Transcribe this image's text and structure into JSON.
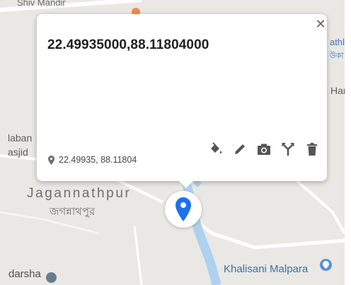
{
  "map": {
    "labels": {
      "top_left": "Shiv Mandir",
      "jagannathpur": "Jagannathpur",
      "jagannathpur_bn": "জগন্নাথপুর",
      "darsha": "darsha",
      "khalisani": "Khalisani Malpara",
      "left_partial_1": "laban",
      "left_partial_2": "asjid",
      "right_partial_1": "athle",
      "right_partial_2": "উকা",
      "right_partial_3": "Har"
    },
    "colors": {
      "land": "#e9e8e4",
      "water": "#aed1ef",
      "road": "#ffffff",
      "marker": "#1a73e8",
      "poi_orange": "#f28b50"
    }
  },
  "popup": {
    "title": "22.49935000,88.11804000",
    "coords": "22.49935, 88.11804",
    "close_icon": "close-icon",
    "tools": [
      "paint-bucket-icon",
      "pencil-icon",
      "camera-icon",
      "directions-icon",
      "trash-icon"
    ]
  },
  "marker": {
    "icon": "location-pin-icon"
  }
}
